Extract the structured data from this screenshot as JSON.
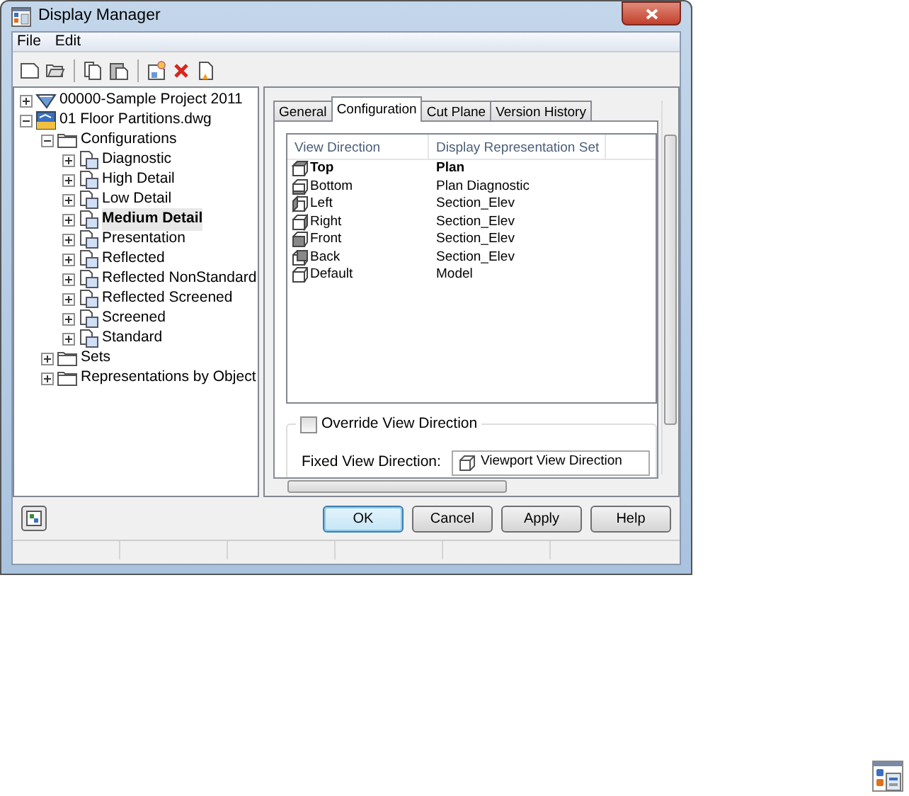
{
  "window": {
    "title": "Display Manager"
  },
  "menu": [
    "File",
    "Edit"
  ],
  "tree": [
    {
      "label": "00000-Sample Project 2011",
      "kind": "project",
      "expanded": false,
      "selected": false
    },
    {
      "label": "01 Floor Partitions.dwg",
      "kind": "drawing",
      "expanded": true,
      "selected": false,
      "children": [
        {
          "label": "Configurations",
          "kind": "folder",
          "expanded": true,
          "selected": false,
          "children": [
            {
              "label": "Diagnostic",
              "kind": "config",
              "expanded": false,
              "selected": false
            },
            {
              "label": "High Detail",
              "kind": "config",
              "expanded": false,
              "selected": false
            },
            {
              "label": "Low Detail",
              "kind": "config",
              "expanded": false,
              "selected": false
            },
            {
              "label": "Medium Detail",
              "kind": "config",
              "expanded": false,
              "selected": true
            },
            {
              "label": "Presentation",
              "kind": "config",
              "expanded": false,
              "selected": false
            },
            {
              "label": "Reflected",
              "kind": "config",
              "expanded": false,
              "selected": false
            },
            {
              "label": "Reflected NonStandard",
              "kind": "config",
              "expanded": false,
              "selected": false
            },
            {
              "label": "Reflected Screened",
              "kind": "config",
              "expanded": false,
              "selected": false
            },
            {
              "label": "Screened",
              "kind": "config",
              "expanded": false,
              "selected": false
            },
            {
              "label": "Standard",
              "kind": "config",
              "expanded": false,
              "selected": false
            }
          ]
        },
        {
          "label": "Sets",
          "kind": "folder",
          "expanded": false,
          "selected": false
        },
        {
          "label": "Representations by Object",
          "kind": "folder",
          "expanded": false,
          "selected": false
        }
      ]
    }
  ],
  "tabs": [
    {
      "label": "General",
      "selected": false
    },
    {
      "label": "Configuration",
      "selected": true
    },
    {
      "label": "Cut Plane",
      "selected": false
    },
    {
      "label": "Version History",
      "selected": false
    }
  ],
  "table": {
    "columns": [
      "View Direction",
      "Display Representation Set"
    ],
    "rows": [
      {
        "direction": "Top",
        "set": "Plan",
        "kind": "top",
        "bold": true
      },
      {
        "direction": "Bottom",
        "set": "Plan Diagnostic",
        "kind": "bottom",
        "bold": false
      },
      {
        "direction": "Left",
        "set": "Section_Elev",
        "kind": "left",
        "bold": false
      },
      {
        "direction": "Right",
        "set": "Section_Elev",
        "kind": "right",
        "bold": false
      },
      {
        "direction": "Front",
        "set": "Section_Elev",
        "kind": "front",
        "bold": false
      },
      {
        "direction": "Back",
        "set": "Section_Elev",
        "kind": "back",
        "bold": false
      },
      {
        "direction": "Default",
        "set": "Model",
        "kind": "default",
        "bold": false
      }
    ]
  },
  "override": {
    "label": "Override View Direction",
    "checked": false
  },
  "fixed_view": {
    "label": "Fixed View Direction:",
    "value": "Viewport View Direction"
  },
  "buttons": [
    {
      "label": "OK",
      "default": true
    },
    {
      "label": "Cancel",
      "default": false
    },
    {
      "label": "Apply",
      "default": false
    },
    {
      "label": "Help",
      "default": false
    }
  ]
}
